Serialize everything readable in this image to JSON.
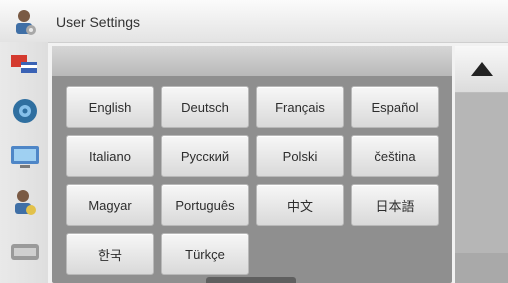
{
  "window": {
    "title": "User Settings"
  },
  "sidebar": {
    "items": [
      {
        "icon": "language-flags-icon"
      },
      {
        "icon": "speaker-icon"
      },
      {
        "icon": "display-icon"
      },
      {
        "icon": "user-settings-icon"
      },
      {
        "icon": "keyboard-icon"
      }
    ]
  },
  "languages": [
    "English",
    "Deutsch",
    "Français",
    "Español",
    "Italiano",
    "Русский",
    "Polski",
    "čeština",
    "Magyar",
    "Português",
    "中文",
    "日本語",
    "한국",
    "Türkçe"
  ],
  "colors": {
    "panel_bg": "#8f8f8f",
    "button_top": "#f7f7f7",
    "button_bottom": "#d9d9d9"
  }
}
